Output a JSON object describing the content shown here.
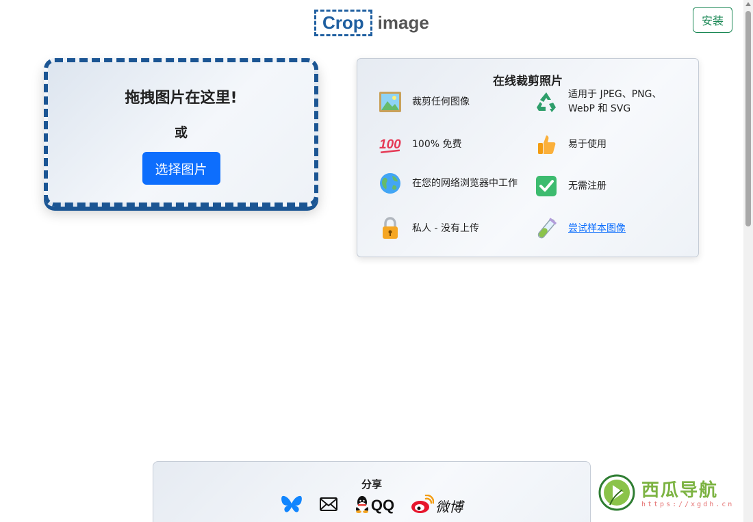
{
  "header": {
    "logo_boxed": "Crop",
    "logo_word": "image",
    "install_label": "安装"
  },
  "dropzone": {
    "title": "拖拽图片在这里!",
    "or": "或",
    "button_label": "选择图片"
  },
  "features": {
    "title": "在线裁剪照片",
    "items": [
      {
        "icon": "picture-icon",
        "text": "裁剪任何图像"
      },
      {
        "icon": "recycle-icon",
        "text": "适用于 JPEG、PNG、WebP 和 SVG"
      },
      {
        "icon": "hundred-icon",
        "text": "100% 免费"
      },
      {
        "icon": "thumbs-up-icon",
        "text": "易于使用"
      },
      {
        "icon": "globe-icon",
        "text": "在您的网络浏览器中工作"
      },
      {
        "icon": "check-mark-icon",
        "text": "无需注册"
      },
      {
        "icon": "lock-icon",
        "text": "私人 - 没有上传"
      },
      {
        "icon": "test-tube-icon",
        "text": "尝试样本图像"
      }
    ]
  },
  "share": {
    "title": "分享",
    "items": [
      {
        "icon": "bluesky-icon"
      },
      {
        "icon": "mail-icon"
      },
      {
        "icon": "qq-icon",
        "label": "QQ"
      },
      {
        "icon": "weibo-icon",
        "label": "微博"
      }
    ]
  },
  "watermark": {
    "title": "西瓜导航",
    "url": "https://xgdh.cn"
  },
  "colors": {
    "primary": "#0d6efd",
    "dropzone_border": "#1b5593",
    "install_green": "#198754"
  }
}
